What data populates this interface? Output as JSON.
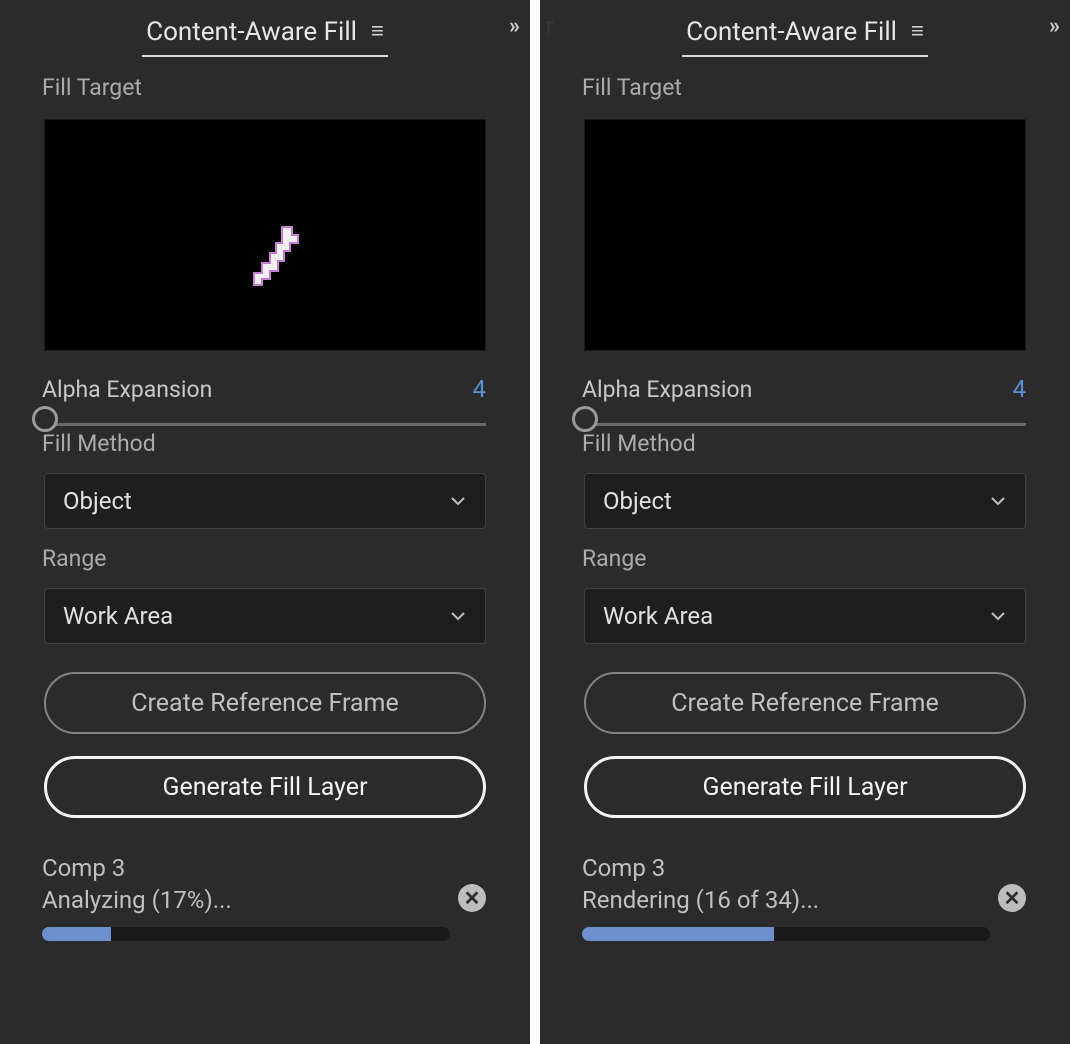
{
  "panels": [
    {
      "title": "Content-Aware Fill",
      "fill_target_label": "Fill Target",
      "show_mask_blob": true,
      "alpha_label": "Alpha Expansion",
      "alpha_value": "4",
      "fill_method_label": "Fill Method",
      "fill_method_value": "Object",
      "range_label": "Range",
      "range_value": "Work Area",
      "ref_button": "Create Reference Frame",
      "gen_button": "Generate Fill Layer",
      "comp_name": "Comp 3",
      "status_text": "Analyzing (17%)...",
      "progress_percent": 17
    },
    {
      "title": "Content-Aware Fill",
      "fill_target_label": "Fill Target",
      "show_mask_blob": false,
      "alpha_label": "Alpha Expansion",
      "alpha_value": "4",
      "fill_method_label": "Fill Method",
      "fill_method_value": "Object",
      "range_label": "Range",
      "range_value": "Work Area",
      "ref_button": "Create Reference Frame",
      "gen_button": "Generate Fill Layer",
      "comp_name": "Comp 3",
      "status_text": "Rendering (16 of 34)...",
      "progress_percent": 47
    }
  ]
}
